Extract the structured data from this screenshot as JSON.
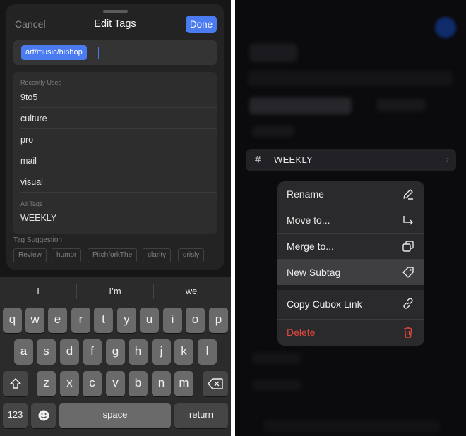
{
  "edit_tags": {
    "cancel": "Cancel",
    "title": "Edit Tags",
    "done": "Done",
    "current_tag": "art/music/hiphop",
    "recently_used_label": "Recently Used",
    "recently_used": [
      "9to5",
      "culture",
      "pro",
      "mail",
      "visual"
    ],
    "all_tags_label": "All Tags",
    "all_tags": [
      "WEEKLY"
    ],
    "suggestion_label": "Tag Suggestion",
    "suggestions": [
      "Review",
      "humor",
      "PitchforkThe",
      "clarity",
      "grisly"
    ]
  },
  "keyboard": {
    "predictions": [
      "I",
      "I’m",
      "we"
    ],
    "row1": [
      "q",
      "w",
      "e",
      "r",
      "t",
      "y",
      "u",
      "i",
      "o",
      "p"
    ],
    "row2": [
      "a",
      "s",
      "d",
      "f",
      "g",
      "h",
      "j",
      "k",
      "l"
    ],
    "row3": [
      "z",
      "x",
      "c",
      "v",
      "b",
      "n",
      "m"
    ],
    "numbers": "123",
    "space": "space",
    "return": "return",
    "shift_icon": "shift-icon",
    "delete_icon": "backspace-icon",
    "emoji_icon": "emoji-icon"
  },
  "context": {
    "tag_label": "WEEKLY",
    "tag_icon": "#",
    "menu": [
      {
        "label": "Rename",
        "icon": "pencil-icon"
      },
      {
        "label": "Move to...",
        "icon": "arrow-turn-icon"
      },
      {
        "label": "Merge to...",
        "icon": "merge-icon"
      },
      {
        "label": "New Subtag",
        "icon": "tag-icon",
        "highlighted": true
      },
      {
        "label": "Copy Cubox Link",
        "icon": "link-icon"
      },
      {
        "label": "Delete",
        "icon": "trash-icon",
        "color": "#e0483e"
      }
    ]
  },
  "colors": {
    "accent": "#4a7bf1",
    "destructive": "#e0483e"
  }
}
